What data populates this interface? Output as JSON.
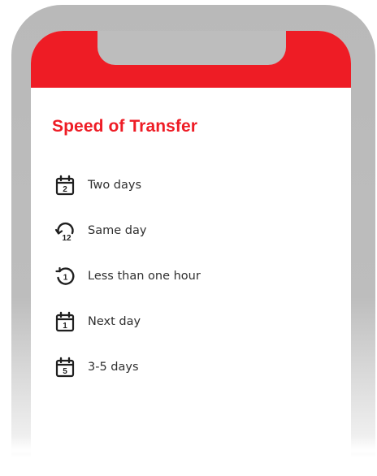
{
  "screen": {
    "accent_color": "#ee1c25",
    "title": "Speed of Transfer"
  },
  "options": [
    {
      "icon": "calendar-2-icon",
      "day_number": "2",
      "label": "Two days"
    },
    {
      "icon": "clock-12-icon",
      "day_number": "12",
      "label": "Same day"
    },
    {
      "icon": "history-1-icon",
      "day_number": "1",
      "label": "Less than one hour"
    },
    {
      "icon": "calendar-1-icon",
      "day_number": "1",
      "label": "Next day"
    },
    {
      "icon": "calendar-5-icon",
      "day_number": "5",
      "label": "3-5 days"
    }
  ]
}
